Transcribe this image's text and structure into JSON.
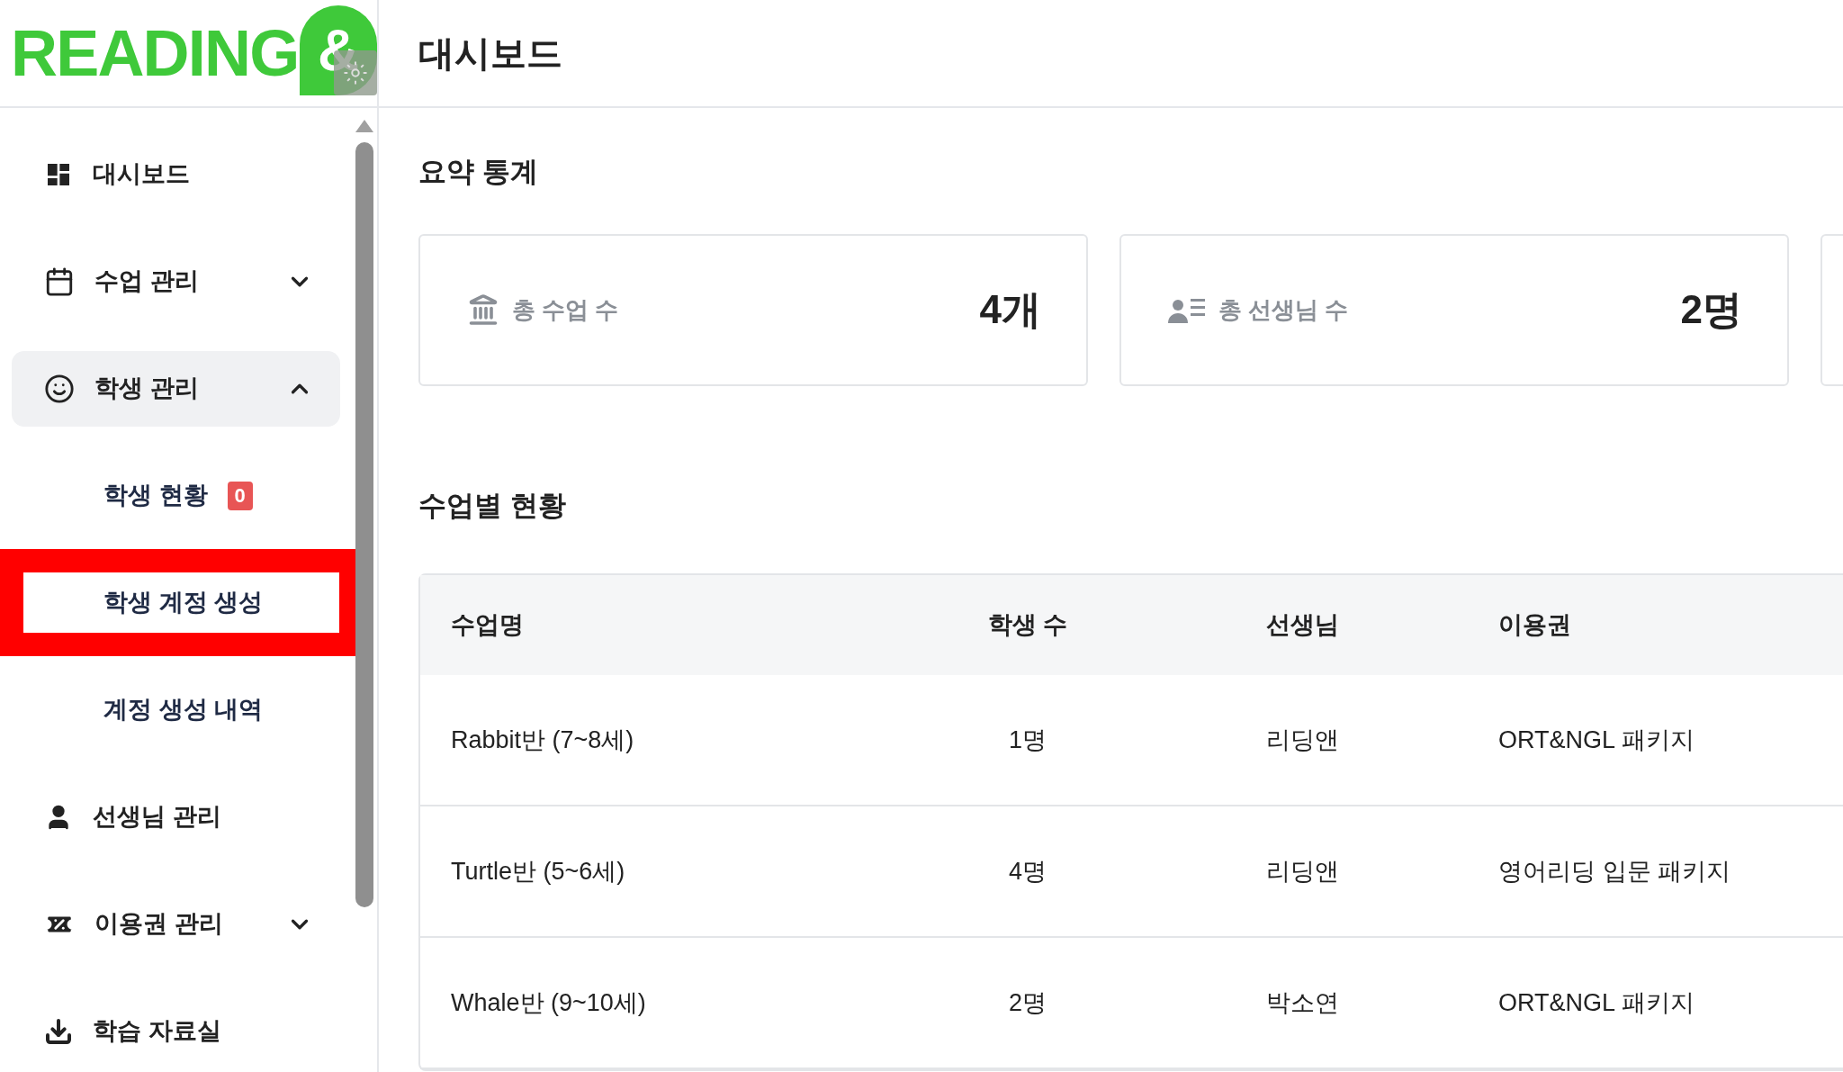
{
  "logo": {
    "text": "READING",
    "mark": "&"
  },
  "header": {
    "title": "대시보드"
  },
  "sidebar": {
    "items": [
      {
        "label": "대시보드",
        "selected": false
      },
      {
        "label": "수업 관리",
        "selected": false,
        "expanded": false
      },
      {
        "label": "학생 관리",
        "selected": true,
        "expanded": true,
        "children": [
          {
            "label": "학생 현황",
            "badge": "0",
            "highlighted": false
          },
          {
            "label": "학생 계정 생성",
            "highlighted": true
          },
          {
            "label": "계정 생성 내역",
            "highlighted": false
          }
        ]
      },
      {
        "label": "선생님 관리",
        "selected": false
      },
      {
        "label": "이용권 관리",
        "selected": false,
        "expanded": false
      },
      {
        "label": "학습 자료실",
        "selected": false
      }
    ]
  },
  "summary": {
    "title": "요약 통계",
    "cards": [
      {
        "label": "총 수업 수",
        "value": "4개"
      },
      {
        "label": "총 선생님 수",
        "value": "2명"
      }
    ]
  },
  "classes": {
    "title": "수업별 현황",
    "columns": [
      "수업명",
      "학생 수",
      "선생님",
      "이용권"
    ],
    "rows": [
      [
        "Rabbit반 (7~8세)",
        "1명",
        "리딩앤",
        "ORT&NGL 패키지"
      ],
      [
        "Turtle반 (5~6세)",
        "4명",
        "리딩앤",
        "영어리딩 입문 패키지"
      ],
      [
        "Whale반 (9~10세)",
        "2명",
        "박소연",
        "ORT&NGL 패키지"
      ]
    ]
  }
}
